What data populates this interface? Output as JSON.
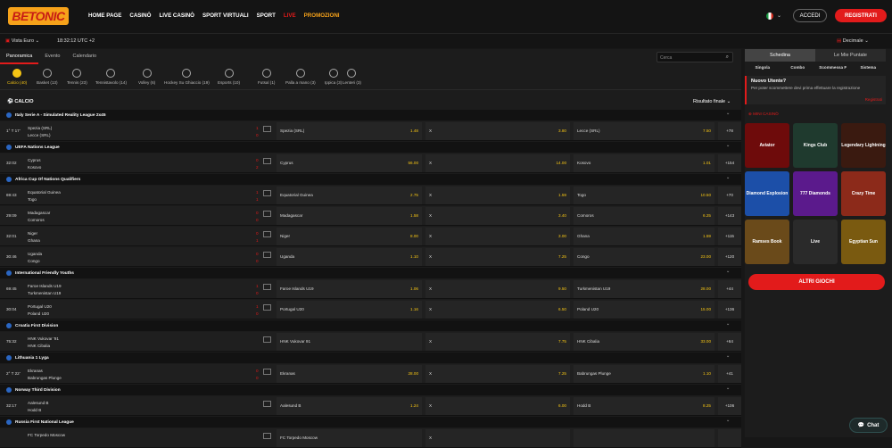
{
  "logo": "BETONIC",
  "nav": [
    "HOME PAGE",
    "CASINÒ",
    "LIVE CASINÒ",
    "SPORT VIRTUALI",
    "SPORT",
    "LIVE",
    "PROMOZIONI"
  ],
  "auth": {
    "login": "ACCEDI",
    "register": "REGISTRATI"
  },
  "subbar": {
    "view": "Vista Euro",
    "time": "18:32:12 UTC +2",
    "odds_format": "Decimale"
  },
  "tabs": [
    "Panoramica",
    "Evento",
    "Calendario"
  ],
  "search": {
    "placeholder": "Cerca"
  },
  "sports": [
    {
      "label": "Calcio (40)"
    },
    {
      "label": "Basket (13)"
    },
    {
      "label": "Tennis (23)"
    },
    {
      "label": "Tennistavolo (14)"
    },
    {
      "label": "Volley (6)"
    },
    {
      "label": "Hockey Su Ghiaccio (19)"
    },
    {
      "label": "Esports (10)"
    },
    {
      "label": "Futsal (1)"
    },
    {
      "label": "Palla a mano (3)"
    },
    {
      "label": "Ippica (3)"
    },
    {
      "label": "Lenteri (3)"
    }
  ],
  "section": {
    "title": "CALCIO",
    "market": "Risultato finale"
  },
  "rows": [
    {
      "type": "league",
      "name": "Italy Serie A - Simulated Reality League 2x45"
    },
    {
      "type": "event",
      "time": "1° T 17'",
      "home": "Spezia (SRL)",
      "away": "Lecce (SRL)",
      "sh": "1",
      "sa": "0",
      "o1": "1.48",
      "ox": "3.80",
      "o2": "7.50",
      "more": "+78"
    },
    {
      "type": "league",
      "name": "UEFA Nations League"
    },
    {
      "type": "event",
      "time": "32:02",
      "home": "Cyprus",
      "away": "Kosovo",
      "sh": "0",
      "sa": "2",
      "o1": "56.00",
      "ox": "14.00",
      "o2": "1.01",
      "more": "+154"
    },
    {
      "type": "league",
      "name": "Africa Cup Of Nations Qualifiers"
    },
    {
      "type": "event",
      "time": "69:43",
      "home": "Equatorial Guinea",
      "away": "Togo",
      "sh": "1",
      "sa": "1",
      "o1": "2.75",
      "ox": "1.59",
      "o2": "10.50",
      "more": "+70"
    },
    {
      "type": "event",
      "time": "29:09",
      "home": "Madagascar",
      "away": "Comoros",
      "sh": "0",
      "sa": "0",
      "o1": "1.58",
      "ox": "3.40",
      "o2": "6.25",
      "more": "+143"
    },
    {
      "type": "event",
      "time": "32:01",
      "home": "Niger",
      "away": "Ghana",
      "sh": "0",
      "sa": "1",
      "o1": "8.00",
      "ox": "3.00",
      "o2": "1.59",
      "more": "+115"
    },
    {
      "type": "event",
      "time": "30:46",
      "home": "Uganda",
      "away": "Congo",
      "sh": "0",
      "sa": "0",
      "o1": "1.10",
      "ox": "7.25",
      "o2": "23.00",
      "more": "+120"
    },
    {
      "type": "league",
      "name": "International Friendly Youths"
    },
    {
      "type": "event",
      "time": "69:45",
      "home": "Faroe Islands U19",
      "away": "Turkmenistan U19",
      "sh": "1",
      "sa": "0",
      "o1": "1.06",
      "ox": "9.50",
      "o2": "28.00",
      "more": "+44"
    },
    {
      "type": "event",
      "time": "30:04",
      "home": "Portugal U20",
      "away": "Poland U20",
      "sh": "1",
      "sa": "0",
      "o1": "1.16",
      "ox": "6.50",
      "o2": "15.00",
      "more": "+136"
    },
    {
      "type": "league",
      "name": "Croatia First Division"
    },
    {
      "type": "event",
      "time": "75:32",
      "home": "HNK Vukovar '91",
      "away": "HNK Cibalia",
      "sh": "",
      "sa": "",
      "o1": "",
      "ox": "7.75",
      "o2": "33.00",
      "more": "+64",
      "home_odds_label": "HNK Vukovar 91"
    },
    {
      "type": "league",
      "name": "Lithuania 1 Lyga"
    },
    {
      "type": "event",
      "time": "2° T 22'",
      "home": "Ekranas",
      "away": "Babrungas Plunge",
      "sh": "0",
      "sa": "0",
      "o1": "28.00",
      "ox": "7.25",
      "o2": "1.10",
      "more": "+41"
    },
    {
      "type": "league",
      "name": "Norway Third Division"
    },
    {
      "type": "event",
      "time": "32:17",
      "home": "Aalesund B",
      "away": "Hodd B",
      "sh": "",
      "sa": "",
      "o1": "1.24",
      "ox": "6.00",
      "o2": "8.25",
      "more": "+106"
    },
    {
      "type": "league",
      "name": "Russia First National League"
    },
    {
      "type": "event",
      "time": "",
      "home": "FC Torpedo Moscow",
      "away": "",
      "sh": "",
      "sa": "",
      "o1": "",
      "ox": "",
      "o2": "",
      "more": ""
    }
  ],
  "betslip": {
    "tab1": "Schedina",
    "tab2": "Le Mie Puntate",
    "types": [
      "Singola",
      "Combo",
      "Scommessa F",
      "Sistema"
    ],
    "info_title": "Nuovo Utente?",
    "info_text": "Per poter scommettere devi prima effettuare la registrazione",
    "info_link": "Registrati"
  },
  "mini_casino": "MINI CASINÒ",
  "games": [
    {
      "name": "Aviator",
      "bg": "#6e0b0b"
    },
    {
      "name": "Kings Club",
      "bg": "#1f3a2e"
    },
    {
      "name": "Legendary Lightning",
      "bg": "#3a1a10"
    },
    {
      "name": "Diamond Explosion",
      "bg": "#1c4fa8"
    },
    {
      "name": "777 Diamonds",
      "bg": "#5b1a8c"
    },
    {
      "name": "Crazy Time",
      "bg": "#8c2a1a"
    },
    {
      "name": "Ramses Book",
      "bg": "#6a4a1a"
    },
    {
      "name": "Live",
      "bg": "#2a2a2a"
    },
    {
      "name": "Egyptian Sun",
      "bg": "#7a5a10"
    }
  ],
  "more_games": "ALTRI GIOCHI",
  "chat": "Chat"
}
